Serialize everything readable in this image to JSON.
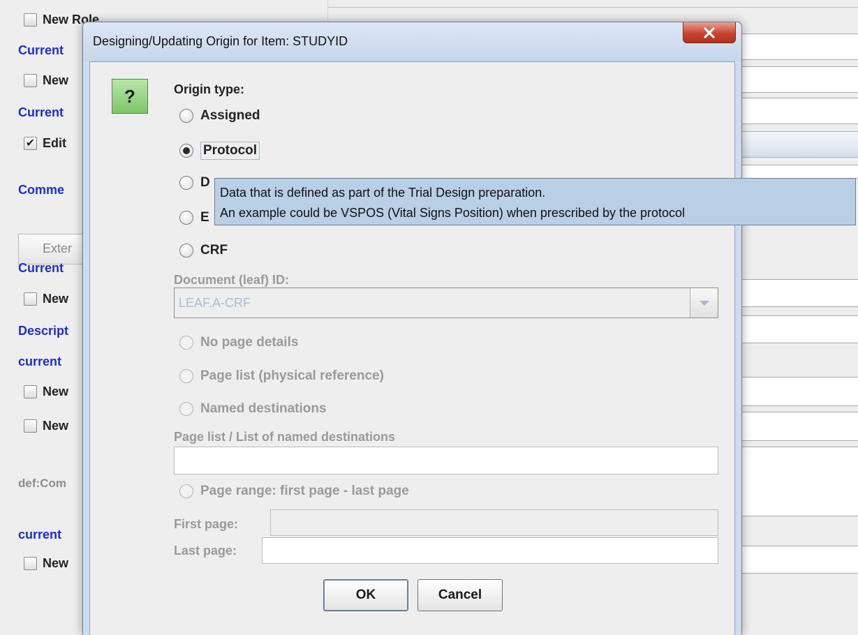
{
  "background": {
    "rows": [
      {
        "kind": "checkbox",
        "label": "New Role",
        "checked": false
      },
      {
        "kind": "label",
        "label": "Current"
      },
      {
        "kind": "checkbox",
        "label": "New",
        "checked": false
      },
      {
        "kind": "label",
        "label": "Current"
      },
      {
        "kind": "checkbox",
        "label": "Edit",
        "checked": true
      },
      {
        "kind": "label",
        "label": "Comme"
      },
      {
        "kind": "button",
        "label": "Exter"
      },
      {
        "kind": "label",
        "label": "Current"
      },
      {
        "kind": "checkbox",
        "label": "New",
        "checked": false
      },
      {
        "kind": "label",
        "label": "Descript"
      },
      {
        "kind": "label",
        "label": "current"
      },
      {
        "kind": "checkbox",
        "label": "New",
        "checked": false
      },
      {
        "kind": "checkbox",
        "label": "New",
        "checked": false
      },
      {
        "kind": "grey",
        "label": "def:Com"
      },
      {
        "kind": "label",
        "label": "current"
      },
      {
        "kind": "checkbox",
        "label": "New",
        "checked": false
      }
    ]
  },
  "dialog": {
    "title": "Designing/Updating Origin for Item: STUDYID",
    "close_icon": "close-x-icon",
    "help_icon": "question-mark-icon",
    "origin_type_label": "Origin type:",
    "origin_options": [
      {
        "label": "Assigned",
        "selected": false
      },
      {
        "label": "Protocol",
        "selected": true
      },
      {
        "label": "D",
        "selected": false
      },
      {
        "label": "E",
        "selected": false
      },
      {
        "label": "CRF",
        "selected": false
      }
    ],
    "document_label": "Document (leaf) ID:",
    "document_value": "LEAF.A-CRF",
    "page_options": [
      {
        "label": "No page details",
        "selected": false
      },
      {
        "label": "Page list (physical reference)",
        "selected": false
      },
      {
        "label": "Named destinations",
        "selected": false
      }
    ],
    "page_list_label": "Page list / List of named destinations",
    "page_list_value": "",
    "page_range_option": "Page range: first page - last page",
    "first_page_label": "First page:",
    "first_page_value": "",
    "last_page_label": "Last page:",
    "last_page_value": "",
    "ok_label": "OK",
    "cancel_label": "Cancel"
  },
  "tooltip": {
    "line1": "Data that is defined as part of the Trial Design preparation.",
    "line2": "An example could be VSPOS (Vital Signs Position) when prescribed by the protocol"
  },
  "colors": {
    "link_blue": "#1a2fd1",
    "tooltip_bg": "#b9cfe6",
    "help_icon_green": "#7dc66a",
    "close_red": "#c9432f"
  }
}
